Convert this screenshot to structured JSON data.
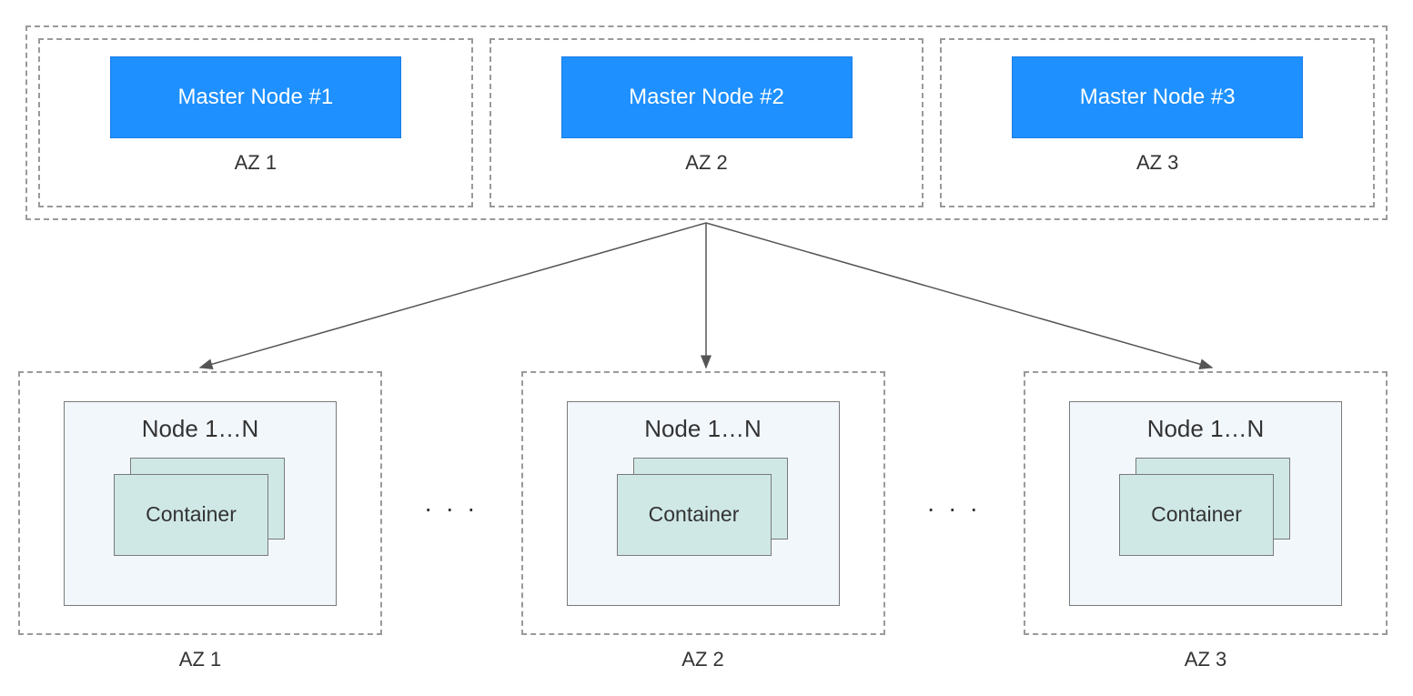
{
  "masters": {
    "items": [
      {
        "node_label": "Master Node #1",
        "az_label": "AZ 1"
      },
      {
        "node_label": "Master Node #2",
        "az_label": "AZ 2"
      },
      {
        "node_label": "Master Node #3",
        "az_label": "AZ 3"
      }
    ]
  },
  "workers": {
    "items": [
      {
        "node_title": "Node 1…N",
        "container_label": "Container",
        "az_label": "AZ 1"
      },
      {
        "node_title": "Node 1…N",
        "container_label": "Container",
        "az_label": "AZ 2"
      },
      {
        "node_title": "Node 1…N",
        "container_label": "Container",
        "az_label": "AZ 3"
      }
    ],
    "ellipsis": ". . ."
  }
}
